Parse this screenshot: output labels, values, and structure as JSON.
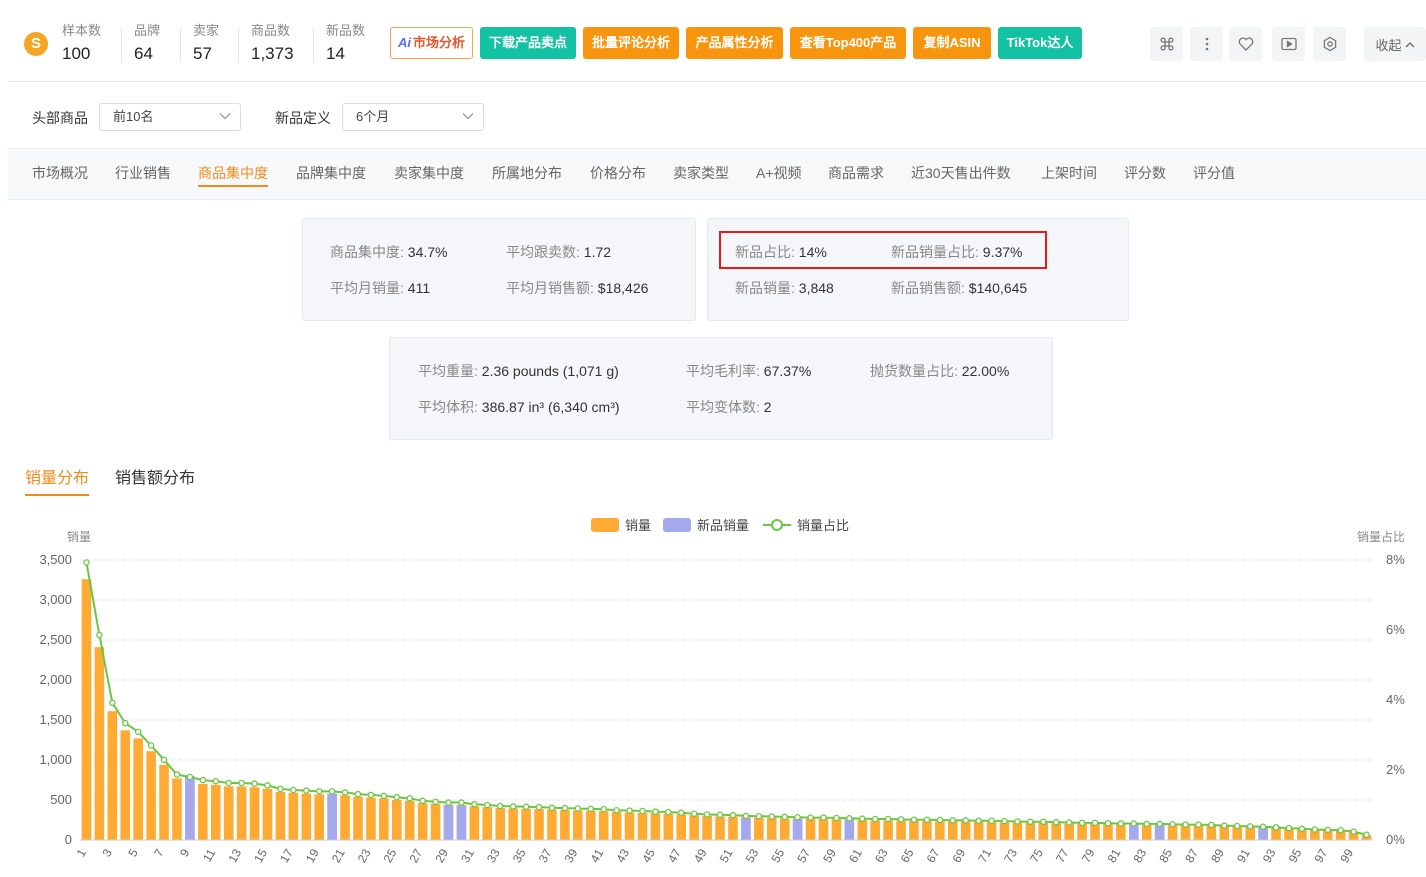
{
  "header": {
    "logo_letter": "S",
    "stats": [
      {
        "label": "样本数",
        "value": "100"
      },
      {
        "label": "品牌",
        "value": "64"
      },
      {
        "label": "卖家",
        "value": "57"
      },
      {
        "label": "商品数",
        "value": "1,373"
      },
      {
        "label": "新品数",
        "value": "14"
      }
    ],
    "buttons": {
      "ai_mark": "Ai",
      "market_analysis": "市场分析",
      "download_points": "下载产品卖点",
      "batch_review": "批量评论分析",
      "attr_analysis": "产品属性分析",
      "top400": "查看Top400产品",
      "copy_asin": "复制ASIN",
      "tiktok": "TikTok达人",
      "collapse": "收起"
    },
    "icons": [
      "command-icon",
      "more-vertical-icon",
      "heart-icon",
      "video-icon",
      "settings-icon"
    ]
  },
  "filters": {
    "head_label": "头部商品",
    "head_value": "前10名",
    "newdef_label": "新品定义",
    "newdef_value": "6个月"
  },
  "tabs": [
    "市场概况",
    "行业销售",
    "商品集中度",
    "品牌集中度",
    "卖家集中度",
    "所属地分布",
    "价格分布",
    "卖家类型",
    "A+视频",
    "商品需求",
    "近30天售出件数",
    "上架时间",
    "评分数",
    "评分值"
  ],
  "active_tab": "商品集中度",
  "metrics": {
    "box1": {
      "concentration_k": "商品集中度:",
      "concentration_v": "34.7%",
      "avg_followers_k": "平均跟卖数:",
      "avg_followers_v": "1.72",
      "avg_monthly_sales_k": "平均月销量:",
      "avg_monthly_sales_v": "411",
      "avg_monthly_revenue_k": "平均月销售额:",
      "avg_monthly_revenue_v": "$18,426"
    },
    "box2": {
      "new_ratio_k": "新品占比:",
      "new_ratio_v": "14%",
      "new_sales_ratio_k": "新品销量占比:",
      "new_sales_ratio_v": "9.37%",
      "new_sales_k": "新品销量:",
      "new_sales_v": "3,848",
      "new_revenue_k": "新品销售额:",
      "new_revenue_v": "$140,645"
    },
    "box3": {
      "avg_weight_k": "平均重量:",
      "avg_weight_v": "2.36 pounds (1,071 g)",
      "avg_margin_k": "平均毛利率:",
      "avg_margin_v": "67.37%",
      "bulky_ratio_k": "抛货数量占比:",
      "bulky_ratio_v": "22.00%",
      "avg_volume_k": "平均体积:",
      "avg_volume_v": "386.87 in³ (6,340 cm³)",
      "avg_variants_k": "平均变体数:",
      "avg_variants_v": "2"
    }
  },
  "chart_tabs": {
    "sales": "销量分布",
    "revenue": "销售额分布",
    "active": "销量分布"
  },
  "chart_data": {
    "type": "bar",
    "ylabel": "销量",
    "y2label": "销量占比",
    "ylim": [
      0,
      3500
    ],
    "y2lim": [
      0,
      8
    ],
    "yticks": [
      "0",
      "500",
      "1,000",
      "1,500",
      "2,000",
      "2,500",
      "3,000",
      "3,500"
    ],
    "y2ticks": [
      "0%",
      "2%",
      "4%",
      "6%",
      "8%"
    ],
    "legend": [
      "销量",
      "新品销量",
      "销量占比"
    ],
    "colors": {
      "sales": "#ffaa33",
      "new_sales": "#a4a9ee",
      "ratio": "#6cc644"
    },
    "x": [
      1,
      2,
      3,
      4,
      5,
      6,
      7,
      8,
      9,
      10,
      11,
      12,
      13,
      14,
      15,
      16,
      17,
      18,
      19,
      20,
      21,
      22,
      23,
      24,
      25,
      26,
      27,
      28,
      29,
      30,
      31,
      32,
      33,
      34,
      35,
      36,
      37,
      38,
      39,
      40,
      41,
      42,
      43,
      44,
      45,
      46,
      47,
      48,
      49,
      50,
      51,
      52,
      53,
      54,
      55,
      56,
      57,
      58,
      59,
      60,
      61,
      62,
      63,
      64,
      65,
      66,
      67,
      68,
      69,
      70,
      71,
      72,
      73,
      74,
      75,
      76,
      77,
      78,
      79,
      80,
      81,
      82,
      83,
      84,
      85,
      86,
      87,
      88,
      89,
      90,
      91,
      92,
      93,
      94,
      95,
      96,
      97,
      98,
      99,
      100
    ],
    "xtick_labels": [
      "1",
      "3",
      "5",
      "7",
      "9",
      "11",
      "13",
      "15",
      "17",
      "19",
      "21",
      "23",
      "25",
      "27",
      "29",
      "31",
      "33",
      "35",
      "37",
      "39",
      "41",
      "43",
      "45",
      "47",
      "49",
      "51",
      "53",
      "55",
      "57",
      "59",
      "61",
      "63",
      "65",
      "67",
      "69",
      "71",
      "73",
      "75",
      "77",
      "79",
      "81",
      "83",
      "85",
      "87",
      "89",
      "91",
      "93",
      "95",
      "97",
      "99"
    ],
    "series": [
      {
        "name": "销量",
        "values": [
          3260,
          2410,
          1610,
          1370,
          1270,
          1110,
          940,
          770,
          740,
          700,
          690,
          670,
          670,
          660,
          640,
          600,
          590,
          580,
          570,
          570,
          560,
          540,
          530,
          520,
          500,
          490,
          460,
          450,
          440,
          440,
          420,
          410,
          400,
          395,
          390,
          385,
          380,
          375,
          370,
          365,
          360,
          350,
          345,
          340,
          335,
          330,
          320,
          310,
          300,
          295,
          290,
          285,
          280,
          275,
          270,
          268,
          265,
          262,
          260,
          255,
          250,
          248,
          245,
          242,
          240,
          238,
          235,
          232,
          230,
          228,
          225,
          220,
          218,
          215,
          212,
          210,
          205,
          202,
          200,
          198,
          195,
          192,
          190,
          188,
          185,
          182,
          180,
          175,
          170,
          165,
          160,
          155,
          150,
          140,
          130,
          125,
          120,
          115,
          100,
          60
        ]
      },
      {
        "name": "新品销量",
        "values": [
          0,
          0,
          0,
          0,
          0,
          0,
          0,
          0,
          800,
          0,
          0,
          0,
          0,
          0,
          0,
          0,
          0,
          0,
          0,
          580,
          0,
          0,
          0,
          0,
          0,
          0,
          0,
          0,
          440,
          430,
          0,
          0,
          0,
          0,
          0,
          0,
          0,
          0,
          0,
          0,
          0,
          0,
          0,
          0,
          0,
          0,
          0,
          0,
          0,
          0,
          0,
          270,
          0,
          0,
          0,
          262,
          0,
          0,
          0,
          258,
          0,
          0,
          0,
          0,
          0,
          0,
          0,
          0,
          0,
          0,
          0,
          0,
          0,
          0,
          0,
          0,
          0,
          0,
          0,
          0,
          0,
          190,
          0,
          188,
          0,
          0,
          0,
          0,
          0,
          0,
          0,
          150,
          0,
          0,
          0,
          0,
          0,
          0,
          0,
          0
        ]
      },
      {
        "name": "销量占比",
        "values": [
          7.93,
          5.86,
          3.92,
          3.34,
          3.09,
          2.7,
          2.29,
          1.87,
          1.8,
          1.71,
          1.68,
          1.63,
          1.63,
          1.61,
          1.56,
          1.46,
          1.43,
          1.41,
          1.39,
          1.39,
          1.36,
          1.31,
          1.29,
          1.26,
          1.22,
          1.19,
          1.12,
          1.09,
          1.07,
          1.07,
          1.02,
          1.0,
          0.97,
          0.96,
          0.95,
          0.94,
          0.92,
          0.91,
          0.9,
          0.89,
          0.88,
          0.85,
          0.84,
          0.83,
          0.81,
          0.8,
          0.78,
          0.75,
          0.73,
          0.72,
          0.71,
          0.69,
          0.68,
          0.67,
          0.66,
          0.65,
          0.64,
          0.64,
          0.63,
          0.62,
          0.61,
          0.6,
          0.6,
          0.59,
          0.58,
          0.58,
          0.57,
          0.56,
          0.56,
          0.55,
          0.55,
          0.54,
          0.53,
          0.52,
          0.52,
          0.51,
          0.5,
          0.49,
          0.49,
          0.48,
          0.47,
          0.47,
          0.46,
          0.46,
          0.45,
          0.44,
          0.44,
          0.43,
          0.41,
          0.4,
          0.39,
          0.38,
          0.36,
          0.34,
          0.32,
          0.3,
          0.29,
          0.28,
          0.24,
          0.15
        ]
      }
    ]
  }
}
